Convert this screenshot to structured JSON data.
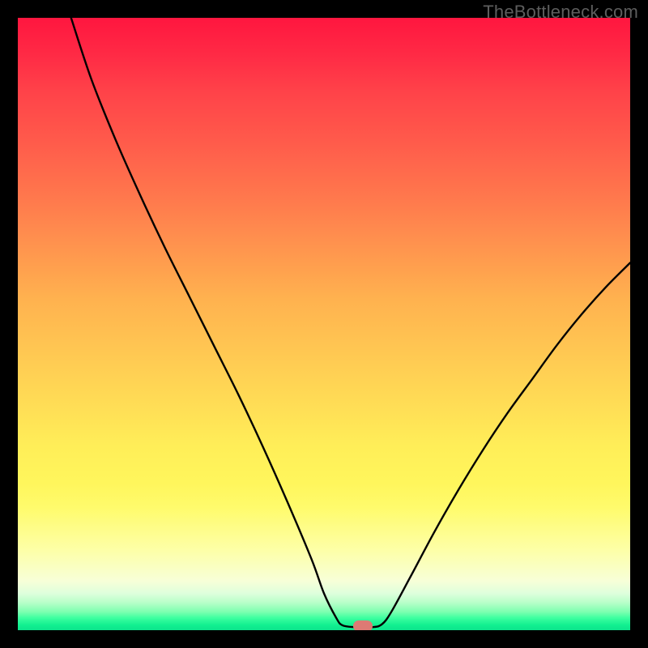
{
  "watermark": "TheBottleneck.com",
  "chart_data": {
    "type": "line",
    "title": "",
    "xlabel": "",
    "ylabel": "",
    "xrange": [
      0,
      100
    ],
    "yrange": [
      0,
      100
    ],
    "marker": {
      "x": 56.3,
      "y": 0.7
    },
    "curve_points": [
      {
        "x": 8.7,
        "y": 100.0
      },
      {
        "x": 12.0,
        "y": 90.0
      },
      {
        "x": 16.0,
        "y": 80.0
      },
      {
        "x": 20.0,
        "y": 71.0
      },
      {
        "x": 24.0,
        "y": 62.5
      },
      {
        "x": 28.0,
        "y": 54.5
      },
      {
        "x": 32.0,
        "y": 46.5
      },
      {
        "x": 36.0,
        "y": 38.5
      },
      {
        "x": 40.0,
        "y": 30.0
      },
      {
        "x": 44.0,
        "y": 21.0
      },
      {
        "x": 48.0,
        "y": 11.5
      },
      {
        "x": 50.0,
        "y": 6.0
      },
      {
        "x": 52.0,
        "y": 2.0
      },
      {
        "x": 53.0,
        "y": 0.8
      },
      {
        "x": 55.0,
        "y": 0.5
      },
      {
        "x": 58.0,
        "y": 0.5
      },
      {
        "x": 59.5,
        "y": 1.0
      },
      {
        "x": 61.0,
        "y": 3.0
      },
      {
        "x": 64.0,
        "y": 8.5
      },
      {
        "x": 68.0,
        "y": 16.0
      },
      {
        "x": 72.0,
        "y": 23.0
      },
      {
        "x": 76.0,
        "y": 29.5
      },
      {
        "x": 80.0,
        "y": 35.5
      },
      {
        "x": 84.0,
        "y": 41.0
      },
      {
        "x": 88.0,
        "y": 46.5
      },
      {
        "x": 92.0,
        "y": 51.5
      },
      {
        "x": 96.0,
        "y": 56.0
      },
      {
        "x": 100.0,
        "y": 60.0
      }
    ],
    "colors": {
      "top": "#ff163f",
      "mid": "#ffee58",
      "bottom": "#0de48c",
      "marker": "#dd7a74",
      "curve": "#000000"
    }
  }
}
